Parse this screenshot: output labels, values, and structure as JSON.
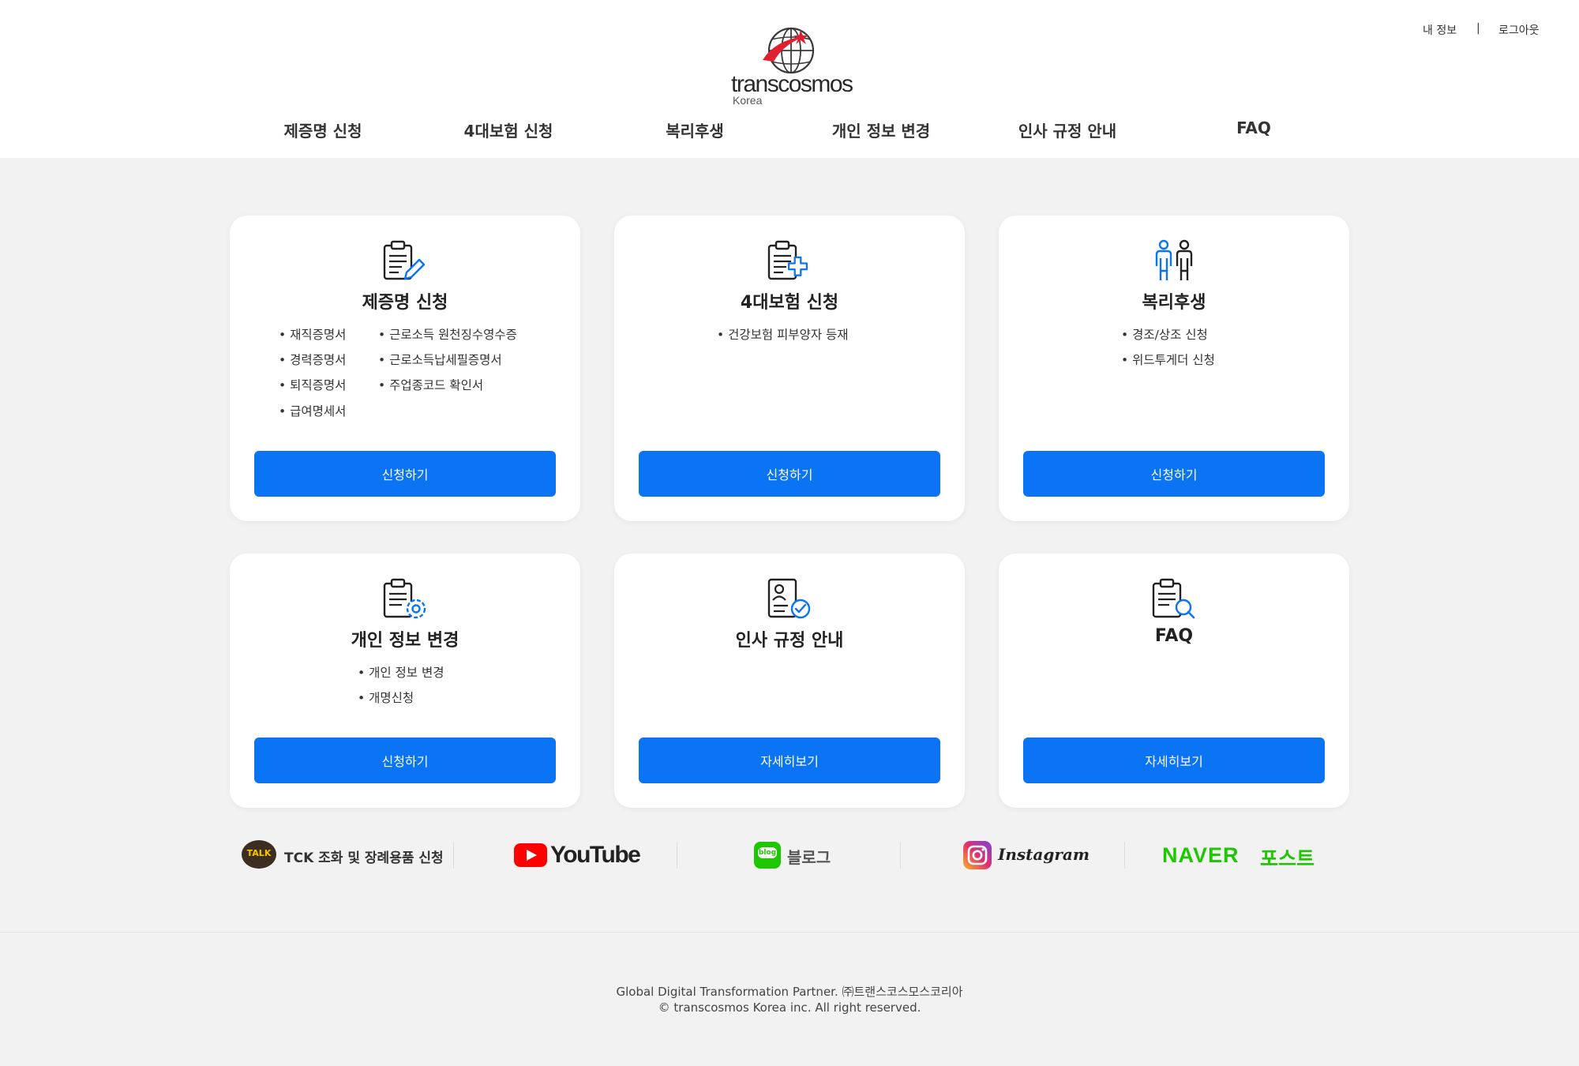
{
  "header": {
    "logo_text": "transcosmos",
    "logo_sub": "Korea",
    "util": {
      "my_info": "내 정보",
      "separator": "|",
      "logout": "로그아웃"
    },
    "nav": [
      "제증명 신청",
      "4대보험 신청",
      "복리후생",
      "개인 정보 변경",
      "인사 규정 안내",
      "FAQ"
    ]
  },
  "cards": [
    {
      "icon": "clipboard-pen-icon",
      "title": "제증명 신청",
      "col1": [
        "재직증명서",
        "경력증명서",
        "퇴직증명서",
        "급여명세서"
      ],
      "col2": [
        "근로소득 원천징수영수증",
        "근로소득납세필증명서",
        "주업종코드 확인서"
      ],
      "button": "신청하기"
    },
    {
      "icon": "clipboard-plus-icon",
      "title": "4대보험 신청",
      "col1": [
        "건강보험 피부양자 등재"
      ],
      "button": "신청하기"
    },
    {
      "icon": "people-icon",
      "title": "복리후생",
      "col1": [
        "경조/상조 신청",
        "위드투게더 신청"
      ],
      "button": "신청하기"
    },
    {
      "icon": "clipboard-gear-icon",
      "title": "개인 정보 변경",
      "col1": [
        "개인 정보 변경",
        "개명신청"
      ],
      "button": "신청하기"
    },
    {
      "icon": "id-check-icon",
      "title": "인사 규정 안내",
      "col1": [],
      "button": "자세히보기"
    },
    {
      "icon": "clipboard-search-icon",
      "title": "FAQ",
      "col1": [],
      "button": "자세히보기"
    }
  ],
  "social": {
    "kakao_badge": "TALK",
    "kakao_label": "TCK 조화 및 장례용품 신청",
    "youtube": "YouTube",
    "blog_badge": "blog",
    "blog_label": "블로그",
    "instagram": "Instagram",
    "naver": "NAVER",
    "naver_post": "포스트"
  },
  "footer": {
    "line1": "Global Digital Transformation Partner. ㈜트랜스코스모스코리아",
    "line2": "© transcosmos Korea inc. All right reserved."
  },
  "colors": {
    "primary": "#0a74f4",
    "accent_red": "#e0202e",
    "background": "#f2f2f2",
    "naver_green": "#1ec800",
    "youtube_red": "#ff0000",
    "kakao_yellow": "#f7c600"
  }
}
